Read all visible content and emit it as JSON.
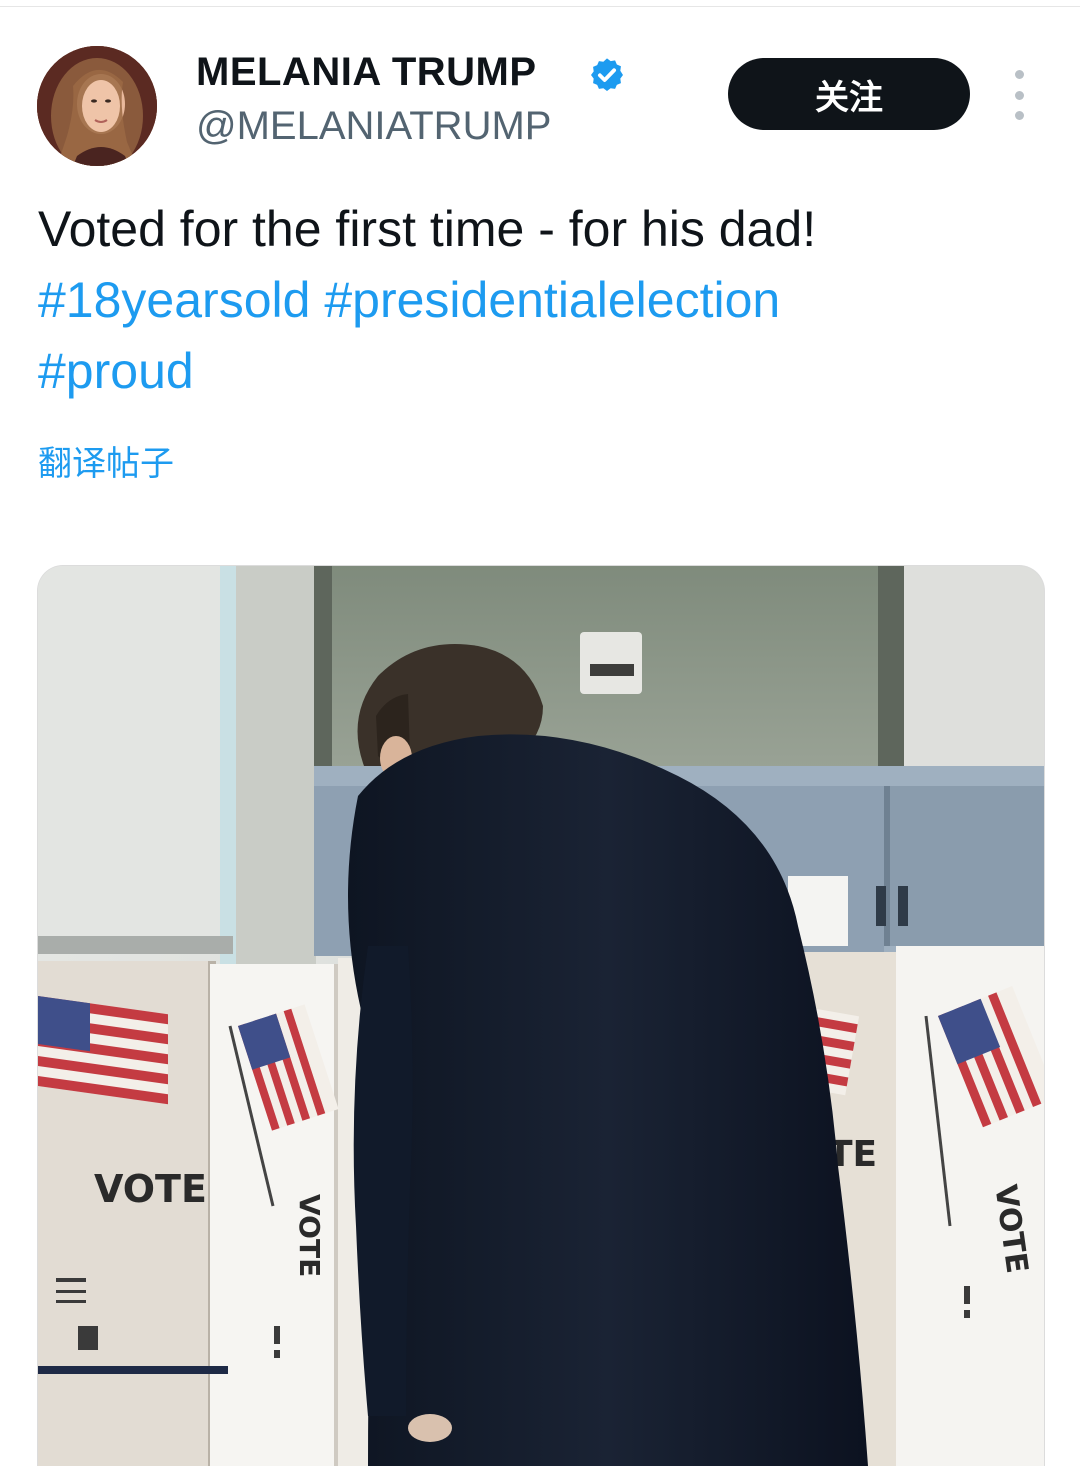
{
  "author": {
    "display_name": "MELANIA TRUMP",
    "handle": "@MELANIATRUMP",
    "verified": true
  },
  "actions": {
    "follow_label": "关注"
  },
  "tweet": {
    "text": "Voted for the first time - for his dad!",
    "hashtags": [
      "#18yearsold",
      "#presidentialelection",
      "#proud"
    ],
    "translate_label": "翻译帖子"
  },
  "media": {
    "booth_labels": [
      "VOTE",
      "VOTE",
      "TE",
      "VOTE"
    ]
  },
  "colors": {
    "link": "#1d9bf0",
    "follow_bg": "#0f1419",
    "verified": "#1d9bf0"
  }
}
